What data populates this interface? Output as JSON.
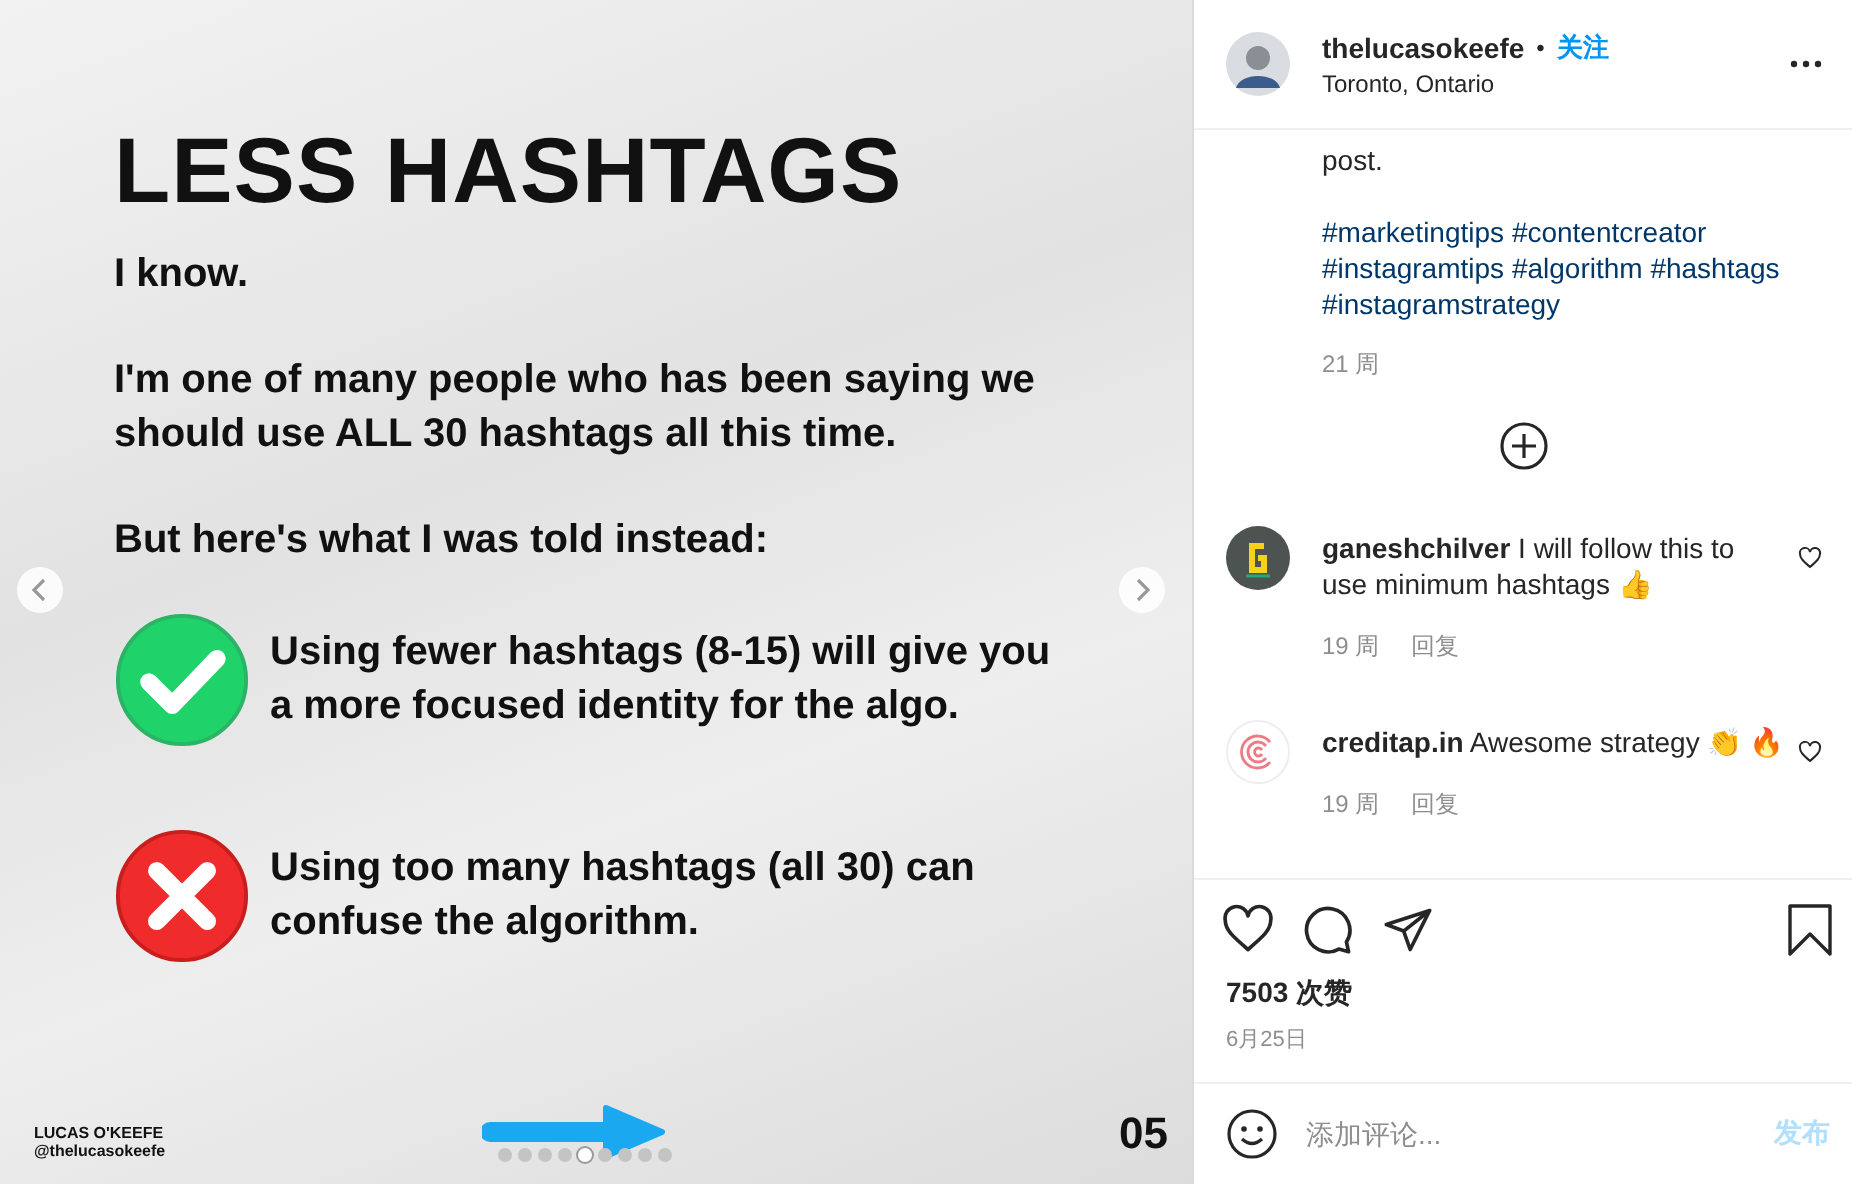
{
  "slide": {
    "title": "LESS HASHTAGS",
    "paragraphs": [
      "I know.",
      "I'm one of many people who has been saying we should use ALL 30 hashtags all this time.",
      "But here's what I was told instead:"
    ],
    "points": [
      {
        "kind": "good",
        "text": "Using fewer hashtags (8-15) will give you a more focused identity for the algo."
      },
      {
        "kind": "bad",
        "text": "Using too many hashtags (all 30) can confuse the algorithm."
      }
    ],
    "author": "LUCAS O'KEEFE",
    "handle": "@thelucasokeefe",
    "page": "05",
    "dots": [
      {
        "selected": false
      },
      {
        "selected": false
      },
      {
        "selected": false
      },
      {
        "selected": false
      },
      {
        "selected": true
      },
      {
        "selected": false
      },
      {
        "selected": false
      },
      {
        "selected": false
      },
      {
        "selected": false
      }
    ]
  },
  "header": {
    "username": "thelucasokeefe",
    "separator": "•",
    "follow": "关注",
    "location": "Toronto, Ontario"
  },
  "caption": {
    "text": "post.",
    "hashtags": [
      "#marketingtips",
      "#contentcreator",
      "#instagramtips",
      "#algorithm",
      "#hashtags",
      "#instagramstrategy"
    ],
    "time": "21 周"
  },
  "comments": [
    {
      "kind": "letter",
      "username": "ganeshchilver",
      "text": "I will follow this to use minimum hashtags 👍",
      "time": "19 周",
      "reply": "回复"
    },
    {
      "kind": "swirl",
      "username": "creditap.in",
      "text": "Awesome strategy 👏 🔥",
      "time": "19 周",
      "reply": "回复"
    }
  ],
  "likes": "7503 次赞",
  "date": "6月25日",
  "comment_box": {
    "placeholder": "添加评论...",
    "post": "发布"
  }
}
